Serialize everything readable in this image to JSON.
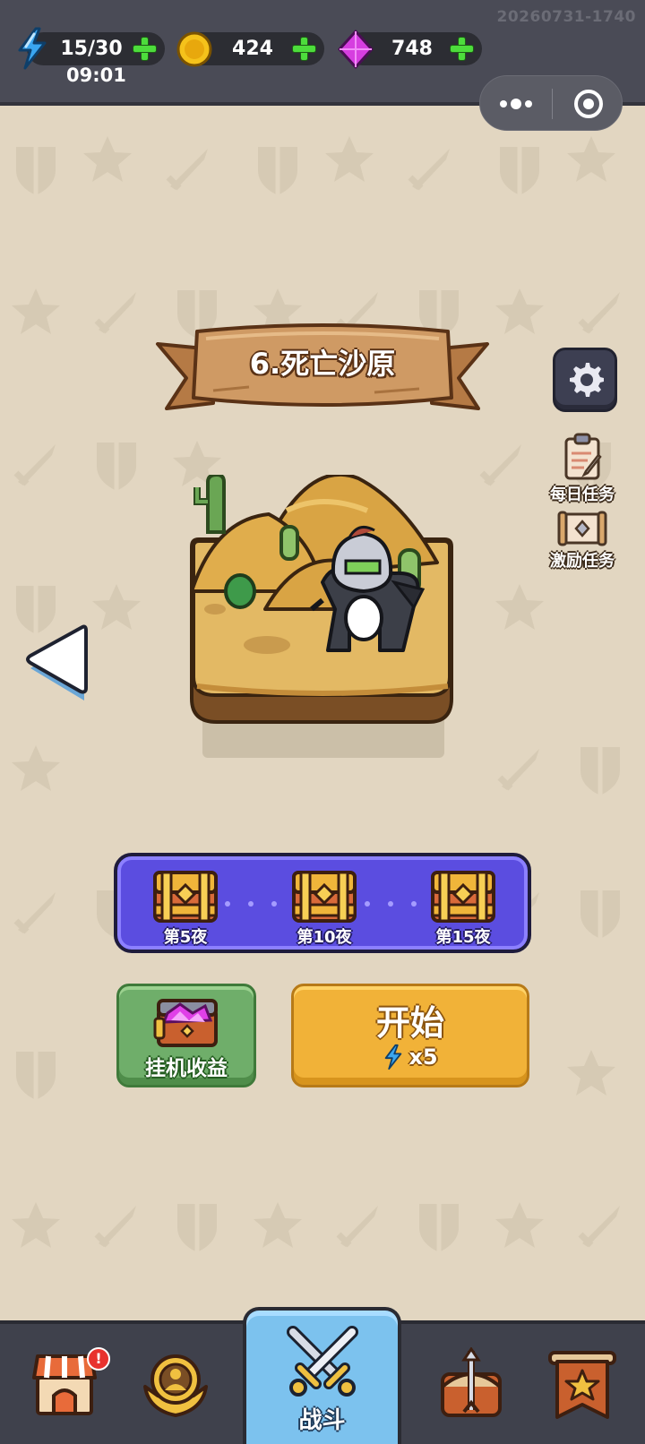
{
  "build_stamp": "20260731-1740",
  "resources": {
    "energy": {
      "value": "15/30",
      "icon": "lightning-icon",
      "color": "#3aa6f0"
    },
    "energy_timer": "09:01",
    "coins": {
      "value": "424",
      "icon": "coin-icon",
      "color": "#f5c21b"
    },
    "gems": {
      "value": "748",
      "icon": "gem-icon",
      "color": "#d63ee0"
    }
  },
  "level": {
    "title": "6.死亡沙原",
    "scene": "desert-island-with-knight"
  },
  "side_menu": {
    "settings_icon": "gear-icon",
    "daily_tasks": "每日任务",
    "incentive_tasks": "激励任务"
  },
  "rewards": {
    "chests": [
      {
        "label": "第5夜"
      },
      {
        "label": "第10夜"
      },
      {
        "label": "第15夜"
      }
    ]
  },
  "buttons": {
    "idle_income": "挂机收益",
    "start": "开始",
    "start_cost": "x5"
  },
  "bottom_nav": {
    "items": [
      {
        "icon": "shop-icon",
        "badge": "!"
      },
      {
        "icon": "hero-emblem-icon"
      },
      {
        "icon": "crossed-swords-icon",
        "label": "战斗",
        "active": true
      },
      {
        "icon": "arrow-shield-icon"
      },
      {
        "icon": "banner-star-icon"
      }
    ]
  },
  "colors": {
    "topbar": "#4a4b56",
    "background": "#e2d6c1",
    "reward_strip": "#5b4de0",
    "idle_button": "#6fae6a",
    "start_button": "#f1b238",
    "active_tab": "#7cc2ee"
  }
}
